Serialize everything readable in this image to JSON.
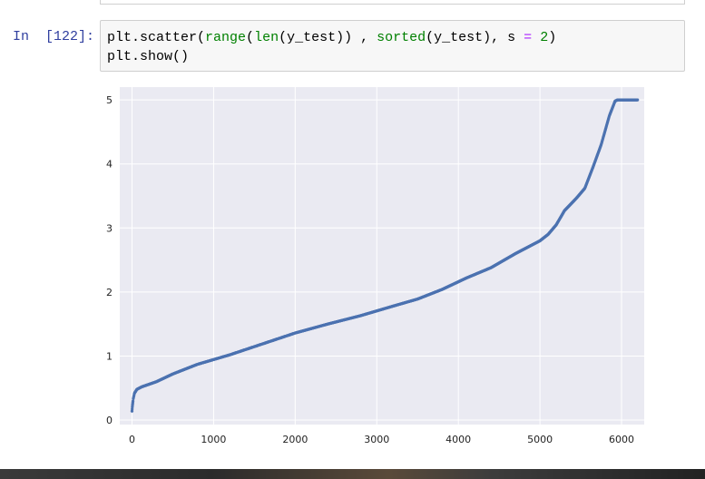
{
  "cell": {
    "prompt": "In  [122]:",
    "code_line1": {
      "p1": "plt.scatter(",
      "p2": "range",
      "p3": "(",
      "p4": "len",
      "p5": "(y_test)) , ",
      "p6": "sorted",
      "p7": "(y_test), s ",
      "p8": "=",
      "p9": " ",
      "p10": "2",
      "p11": ")"
    },
    "code_line2": "plt.show()"
  },
  "colors": {
    "plot_bg": "#eaeaf2",
    "grid": "#ffffff",
    "marker": "#4c72b0",
    "prompt": "#303f9f",
    "builtin": "#008000",
    "operator": "#aa22ff"
  },
  "chart_data": {
    "type": "scatter",
    "style": "seaborn-darkgrid",
    "xlim": [
      -150,
      6400
    ],
    "ylim": [
      -0.07,
      5.2
    ],
    "x_ticks": [
      0,
      1000,
      2000,
      3000,
      4000,
      5000,
      6000
    ],
    "x_tick_labels": [
      "0",
      "1000",
      "2000",
      "3000",
      "4000",
      "5000",
      "6000"
    ],
    "y_ticks": [
      0,
      1,
      2,
      3,
      4,
      5
    ],
    "y_tick_labels": [
      "0",
      "1",
      "2",
      "3",
      "4",
      "5"
    ],
    "grid": true,
    "n_points": 6200,
    "curve_knots": {
      "x": [
        0,
        5,
        15,
        30,
        60,
        120,
        300,
        500,
        800,
        1200,
        1600,
        2000,
        2400,
        2800,
        3200,
        3500,
        3800,
        4100,
        4400,
        4700,
        4850,
        5000,
        5100,
        5200,
        5300,
        5450,
        5550,
        5650,
        5750,
        5850,
        5920,
        5950,
        6000,
        6100,
        6200
      ],
      "y": [
        0.14,
        0.22,
        0.33,
        0.42,
        0.48,
        0.52,
        0.6,
        0.72,
        0.87,
        1.02,
        1.19,
        1.36,
        1.5,
        1.63,
        1.78,
        1.89,
        2.04,
        2.22,
        2.38,
        2.6,
        2.7,
        2.8,
        2.9,
        3.05,
        3.27,
        3.47,
        3.62,
        3.95,
        4.3,
        4.75,
        4.98,
        5.0,
        5.0,
        5.0,
        5.0
      ]
    }
  }
}
